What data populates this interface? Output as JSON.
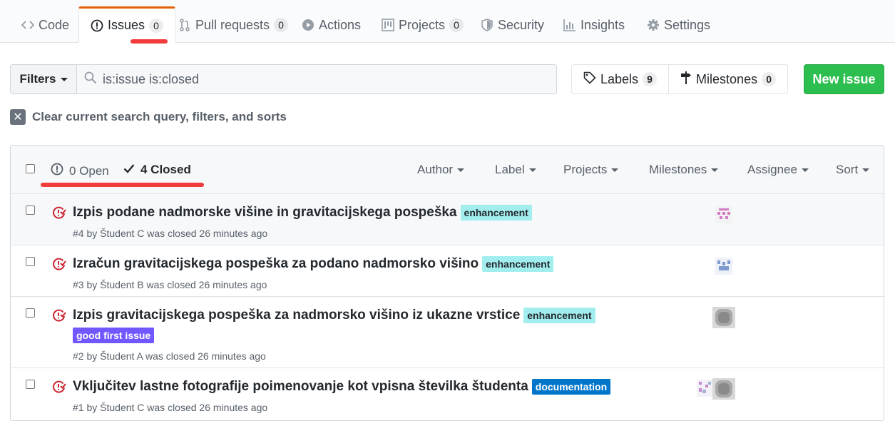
{
  "tabs": [
    {
      "label": "Code",
      "icon": "code-icon",
      "count": null
    },
    {
      "label": "Issues",
      "icon": "issue-opened-icon",
      "count": "0"
    },
    {
      "label": "Pull requests",
      "icon": "git-pull-request-icon",
      "count": "0"
    },
    {
      "label": "Actions",
      "icon": "play-icon",
      "count": null
    },
    {
      "label": "Projects",
      "icon": "project-icon",
      "count": "0"
    },
    {
      "label": "Security",
      "icon": "shield-icon",
      "count": null
    },
    {
      "label": "Insights",
      "icon": "graph-icon",
      "count": null
    },
    {
      "label": "Settings",
      "icon": "gear-icon",
      "count": null
    }
  ],
  "toolbar": {
    "filters_label": "Filters",
    "search_value": "is:issue is:closed",
    "labels_label": "Labels",
    "labels_count": "9",
    "milestones_label": "Milestones",
    "milestones_count": "0",
    "new_issue_label": "New issue",
    "clear_label": "Clear current search query, filters, and sorts"
  },
  "list_header": {
    "open_label": "0 Open",
    "closed_label": "4 Closed",
    "filters": [
      "Author",
      "Label",
      "Projects",
      "Milestones",
      "Assignee",
      "Sort"
    ]
  },
  "issues": [
    {
      "title": "Izpis podane nadmorske višine in gravitacijskega pospeška",
      "labels": [
        {
          "name": "enhancement",
          "color": "#a2eeef",
          "text_color": "#24292e"
        }
      ],
      "meta": "#4 by Študent C was closed 26 minutes ago"
    },
    {
      "title": "Izračun gravitacijskega pospeška za podano nadmorsko višino",
      "labels": [
        {
          "name": "enhancement",
          "color": "#a2eeef",
          "text_color": "#24292e"
        }
      ],
      "meta": "#3 by Študent B was closed 26 minutes ago"
    },
    {
      "title": "Izpis gravitacijskega pospeška za nadmorsko višino iz ukazne vrstice",
      "labels": [
        {
          "name": "enhancement",
          "color": "#a2eeef",
          "text_color": "#24292e"
        },
        {
          "name": "good first issue",
          "color": "#7057ff",
          "text_color": "#ffffff"
        }
      ],
      "meta": "#2 by Študent A was closed 26 minutes ago"
    },
    {
      "title": "Vključitev lastne fotografije poimenovanje kot vpisna številka študenta",
      "labels": [
        {
          "name": "documentation",
          "color": "#0075ca",
          "text_color": "#ffffff"
        }
      ],
      "meta": "#1 by Študent C was closed 26 minutes ago"
    }
  ],
  "colors": {
    "accent_tab": "#e36209",
    "annotation_red": "#f23b3b",
    "closed_icon": "#cb2431",
    "new_issue_green": "#2cbe4e"
  }
}
